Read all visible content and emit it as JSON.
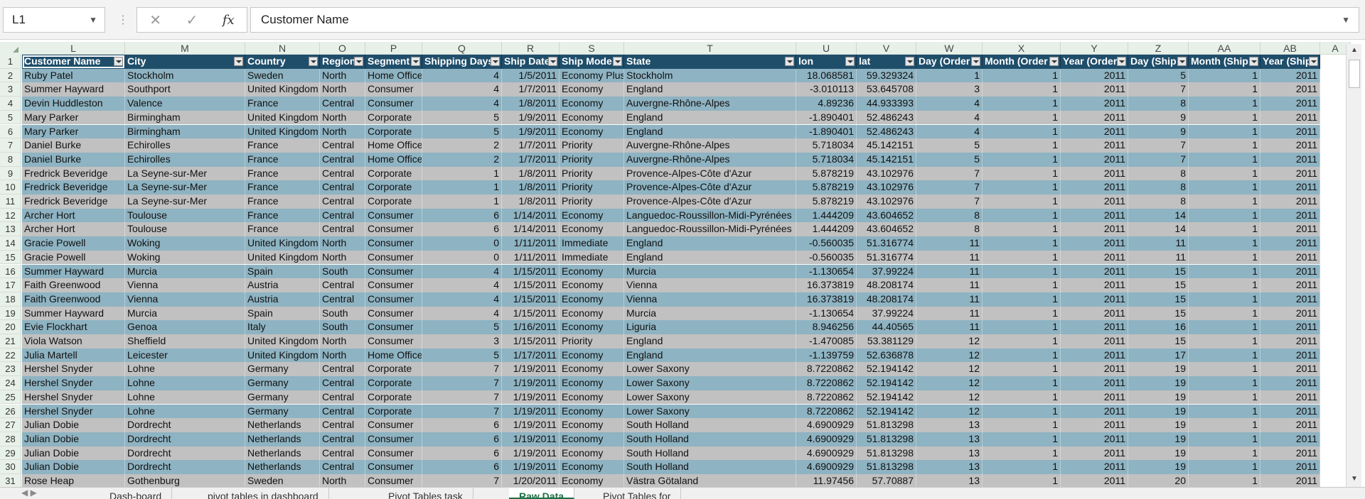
{
  "formula_bar": {
    "name_box": "L1",
    "cancel_icon": "✕",
    "enter_icon": "✓",
    "fx_label": "fx",
    "value": "Customer Name"
  },
  "columns": [
    "L",
    "M",
    "N",
    "O",
    "P",
    "Q",
    "R",
    "S",
    "T",
    "U",
    "V",
    "W",
    "X",
    "Y",
    "Z",
    "AA",
    "AB",
    "A"
  ],
  "headers": [
    "Customer Name",
    "City",
    "Country",
    "Region",
    "Segment",
    "Shipping Days",
    "Ship Date",
    "Ship Mode",
    "State",
    "lon",
    "lat",
    "Day (Order",
    "Month (Order",
    "Year (Order",
    "Day (Ship",
    "Month (Ship",
    "Year (Ship"
  ],
  "rows": [
    {
      "n": "2",
      "c": [
        "Ruby Patel",
        "Stockholm",
        "Sweden",
        "North",
        "Home Office",
        "4",
        "1/5/2011",
        "Economy Plus",
        "Stockholm",
        "18.068581",
        "59.329324",
        "1",
        "1",
        "2011",
        "5",
        "1",
        "2011"
      ]
    },
    {
      "n": "3",
      "c": [
        "Summer Hayward",
        "Southport",
        "United Kingdom",
        "North",
        "Consumer",
        "4",
        "1/7/2011",
        "Economy",
        "England",
        "-3.010113",
        "53.645708",
        "3",
        "1",
        "2011",
        "7",
        "1",
        "2011"
      ]
    },
    {
      "n": "4",
      "c": [
        "Devin Huddleston",
        "Valence",
        "France",
        "Central",
        "Consumer",
        "4",
        "1/8/2011",
        "Economy",
        "Auvergne-Rhône-Alpes",
        "4.89236",
        "44.933393",
        "4",
        "1",
        "2011",
        "8",
        "1",
        "2011"
      ]
    },
    {
      "n": "5",
      "c": [
        "Mary Parker",
        "Birmingham",
        "United Kingdom",
        "North",
        "Corporate",
        "5",
        "1/9/2011",
        "Economy",
        "England",
        "-1.890401",
        "52.486243",
        "4",
        "1",
        "2011",
        "9",
        "1",
        "2011"
      ]
    },
    {
      "n": "6",
      "c": [
        "Mary Parker",
        "Birmingham",
        "United Kingdom",
        "North",
        "Corporate",
        "5",
        "1/9/2011",
        "Economy",
        "England",
        "-1.890401",
        "52.486243",
        "4",
        "1",
        "2011",
        "9",
        "1",
        "2011"
      ]
    },
    {
      "n": "7",
      "c": [
        "Daniel Burke",
        "Echirolles",
        "France",
        "Central",
        "Home Office",
        "2",
        "1/7/2011",
        "Priority",
        "Auvergne-Rhône-Alpes",
        "5.718034",
        "45.142151",
        "5",
        "1",
        "2011",
        "7",
        "1",
        "2011"
      ]
    },
    {
      "n": "8",
      "c": [
        "Daniel Burke",
        "Echirolles",
        "France",
        "Central",
        "Home Office",
        "2",
        "1/7/2011",
        "Priority",
        "Auvergne-Rhône-Alpes",
        "5.718034",
        "45.142151",
        "5",
        "1",
        "2011",
        "7",
        "1",
        "2011"
      ]
    },
    {
      "n": "9",
      "c": [
        "Fredrick Beveridge",
        "La Seyne-sur-Mer",
        "France",
        "Central",
        "Corporate",
        "1",
        "1/8/2011",
        "Priority",
        "Provence-Alpes-Côte d'Azur",
        "5.878219",
        "43.102976",
        "7",
        "1",
        "2011",
        "8",
        "1",
        "2011"
      ]
    },
    {
      "n": "10",
      "c": [
        "Fredrick Beveridge",
        "La Seyne-sur-Mer",
        "France",
        "Central",
        "Corporate",
        "1",
        "1/8/2011",
        "Priority",
        "Provence-Alpes-Côte d'Azur",
        "5.878219",
        "43.102976",
        "7",
        "1",
        "2011",
        "8",
        "1",
        "2011"
      ]
    },
    {
      "n": "11",
      "c": [
        "Fredrick Beveridge",
        "La Seyne-sur-Mer",
        "France",
        "Central",
        "Corporate",
        "1",
        "1/8/2011",
        "Priority",
        "Provence-Alpes-Côte d'Azur",
        "5.878219",
        "43.102976",
        "7",
        "1",
        "2011",
        "8",
        "1",
        "2011"
      ]
    },
    {
      "n": "12",
      "c": [
        "Archer Hort",
        "Toulouse",
        "France",
        "Central",
        "Consumer",
        "6",
        "1/14/2011",
        "Economy",
        "Languedoc-Roussillon-Midi-Pyrénées",
        "1.444209",
        "43.604652",
        "8",
        "1",
        "2011",
        "14",
        "1",
        "2011"
      ]
    },
    {
      "n": "13",
      "c": [
        "Archer Hort",
        "Toulouse",
        "France",
        "Central",
        "Consumer",
        "6",
        "1/14/2011",
        "Economy",
        "Languedoc-Roussillon-Midi-Pyrénées",
        "1.444209",
        "43.604652",
        "8",
        "1",
        "2011",
        "14",
        "1",
        "2011"
      ]
    },
    {
      "n": "14",
      "c": [
        "Gracie Powell",
        "Woking",
        "United Kingdom",
        "North",
        "Consumer",
        "0",
        "1/11/2011",
        "Immediate",
        "England",
        "-0.560035",
        "51.316774",
        "11",
        "1",
        "2011",
        "11",
        "1",
        "2011"
      ]
    },
    {
      "n": "15",
      "c": [
        "Gracie Powell",
        "Woking",
        "United Kingdom",
        "North",
        "Consumer",
        "0",
        "1/11/2011",
        "Immediate",
        "England",
        "-0.560035",
        "51.316774",
        "11",
        "1",
        "2011",
        "11",
        "1",
        "2011"
      ]
    },
    {
      "n": "16",
      "c": [
        "Summer Hayward",
        "Murcia",
        "Spain",
        "South",
        "Consumer",
        "4",
        "1/15/2011",
        "Economy",
        "Murcia",
        "-1.130654",
        "37.99224",
        "11",
        "1",
        "2011",
        "15",
        "1",
        "2011"
      ]
    },
    {
      "n": "17",
      "c": [
        "Faith Greenwood",
        "Vienna",
        "Austria",
        "Central",
        "Consumer",
        "4",
        "1/15/2011",
        "Economy",
        "Vienna",
        "16.373819",
        "48.208174",
        "11",
        "1",
        "2011",
        "15",
        "1",
        "2011"
      ]
    },
    {
      "n": "18",
      "c": [
        "Faith Greenwood",
        "Vienna",
        "Austria",
        "Central",
        "Consumer",
        "4",
        "1/15/2011",
        "Economy",
        "Vienna",
        "16.373819",
        "48.208174",
        "11",
        "1",
        "2011",
        "15",
        "1",
        "2011"
      ]
    },
    {
      "n": "19",
      "c": [
        "Summer Hayward",
        "Murcia",
        "Spain",
        "South",
        "Consumer",
        "4",
        "1/15/2011",
        "Economy",
        "Murcia",
        "-1.130654",
        "37.99224",
        "11",
        "1",
        "2011",
        "15",
        "1",
        "2011"
      ]
    },
    {
      "n": "20",
      "c": [
        "Evie Flockhart",
        "Genoa",
        "Italy",
        "South",
        "Consumer",
        "5",
        "1/16/2011",
        "Economy",
        "Liguria",
        "8.946256",
        "44.40565",
        "11",
        "1",
        "2011",
        "16",
        "1",
        "2011"
      ]
    },
    {
      "n": "21",
      "c": [
        "Viola Watson",
        "Sheffield",
        "United Kingdom",
        "North",
        "Consumer",
        "3",
        "1/15/2011",
        "Priority",
        "England",
        "-1.470085",
        "53.381129",
        "12",
        "1",
        "2011",
        "15",
        "1",
        "2011"
      ]
    },
    {
      "n": "22",
      "c": [
        "Julia Martell",
        "Leicester",
        "United Kingdom",
        "North",
        "Home Office",
        "5",
        "1/17/2011",
        "Economy",
        "England",
        "-1.139759",
        "52.636878",
        "12",
        "1",
        "2011",
        "17",
        "1",
        "2011"
      ]
    },
    {
      "n": "23",
      "c": [
        "Hershel Snyder",
        "Lohne",
        "Germany",
        "Central",
        "Corporate",
        "7",
        "1/19/2011",
        "Economy",
        "Lower Saxony",
        "8.7220862",
        "52.194142",
        "12",
        "1",
        "2011",
        "19",
        "1",
        "2011"
      ]
    },
    {
      "n": "24",
      "c": [
        "Hershel Snyder",
        "Lohne",
        "Germany",
        "Central",
        "Corporate",
        "7",
        "1/19/2011",
        "Economy",
        "Lower Saxony",
        "8.7220862",
        "52.194142",
        "12",
        "1",
        "2011",
        "19",
        "1",
        "2011"
      ]
    },
    {
      "n": "25",
      "c": [
        "Hershel Snyder",
        "Lohne",
        "Germany",
        "Central",
        "Corporate",
        "7",
        "1/19/2011",
        "Economy",
        "Lower Saxony",
        "8.7220862",
        "52.194142",
        "12",
        "1",
        "2011",
        "19",
        "1",
        "2011"
      ]
    },
    {
      "n": "26",
      "c": [
        "Hershel Snyder",
        "Lohne",
        "Germany",
        "Central",
        "Corporate",
        "7",
        "1/19/2011",
        "Economy",
        "Lower Saxony",
        "8.7220862",
        "52.194142",
        "12",
        "1",
        "2011",
        "19",
        "1",
        "2011"
      ]
    },
    {
      "n": "27",
      "c": [
        "Julian Dobie",
        "Dordrecht",
        "Netherlands",
        "Central",
        "Consumer",
        "6",
        "1/19/2011",
        "Economy",
        "South Holland",
        "4.6900929",
        "51.813298",
        "13",
        "1",
        "2011",
        "19",
        "1",
        "2011"
      ]
    },
    {
      "n": "28",
      "c": [
        "Julian Dobie",
        "Dordrecht",
        "Netherlands",
        "Central",
        "Consumer",
        "6",
        "1/19/2011",
        "Economy",
        "South Holland",
        "4.6900929",
        "51.813298",
        "13",
        "1",
        "2011",
        "19",
        "1",
        "2011"
      ]
    },
    {
      "n": "29",
      "c": [
        "Julian Dobie",
        "Dordrecht",
        "Netherlands",
        "Central",
        "Consumer",
        "6",
        "1/19/2011",
        "Economy",
        "South Holland",
        "4.6900929",
        "51.813298",
        "13",
        "1",
        "2011",
        "19",
        "1",
        "2011"
      ]
    },
    {
      "n": "30",
      "c": [
        "Julian Dobie",
        "Dordrecht",
        "Netherlands",
        "Central",
        "Consumer",
        "6",
        "1/19/2011",
        "Economy",
        "South Holland",
        "4.6900929",
        "51.813298",
        "13",
        "1",
        "2011",
        "19",
        "1",
        "2011"
      ]
    },
    {
      "n": "31",
      "c": [
        "Rose Heap",
        "Gothenburg",
        "Sweden",
        "North",
        "Consumer",
        "7",
        "1/20/2011",
        "Economy",
        "Västra Götaland",
        "11.97456",
        "57.70887",
        "13",
        "1",
        "2011",
        "20",
        "1",
        "2011"
      ]
    }
  ],
  "tabs": [
    {
      "label": "Dash-board",
      "active": false
    },
    {
      "label": "pivot tables in dashboard",
      "active": false
    },
    {
      "label": "Pivot Tables task",
      "active": false
    },
    {
      "label": "Raw Data",
      "active": true
    },
    {
      "label": "Pivot Tables for",
      "active": false
    }
  ],
  "colors": {
    "header_row": "#1f4e6b",
    "band_blue": "#8eb3c2",
    "band_gray": "#c1c1c1",
    "active_tab": "#1e7145"
  }
}
